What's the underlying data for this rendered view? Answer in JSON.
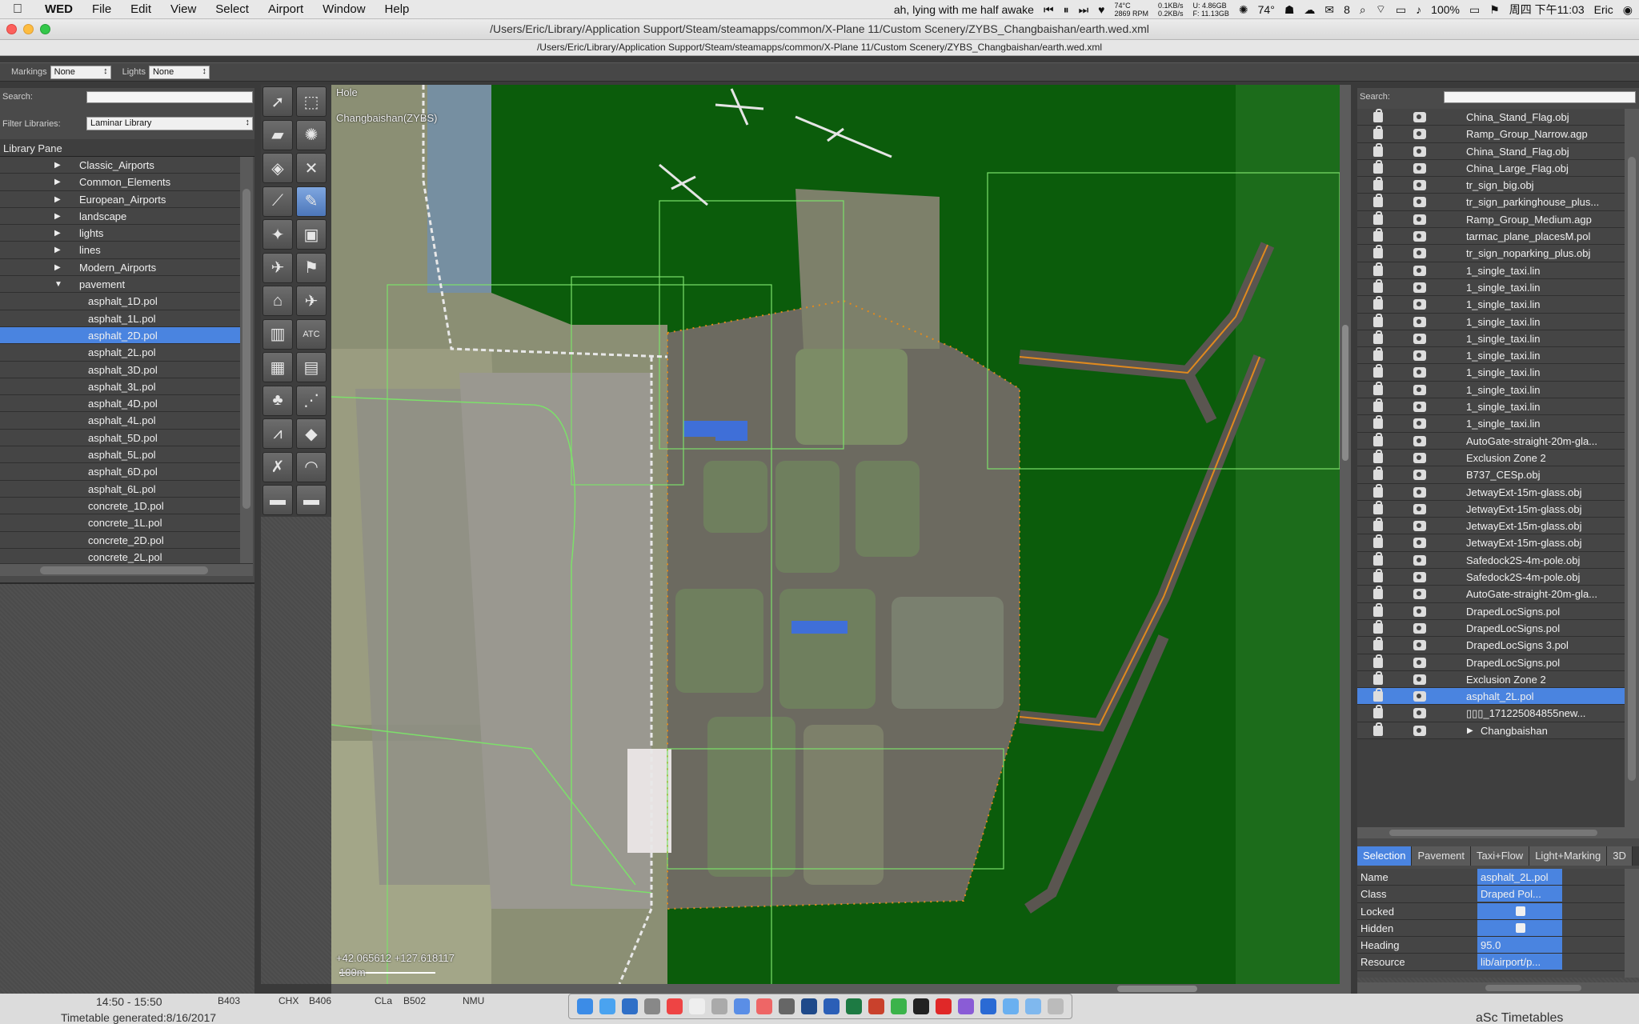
{
  "menubar": {
    "app": "WED",
    "items": [
      "File",
      "Edit",
      "View",
      "Select",
      "Airport",
      "Window",
      "Help"
    ],
    "now_playing": "ah, lying with me half awake",
    "cpu_temp": "74°C",
    "rpm": "2869 RPM",
    "net_up": "0.1KB/s",
    "net_down": "0.2KB/s",
    "mem_used": "U: 4.86GB",
    "mem_free": "F: 11.13GB",
    "weather": "74°",
    "wechat_count": "8",
    "battery": "100%",
    "clock": "周四 下午11:03",
    "user": "Eric"
  },
  "window": {
    "title": "/Users/Eric/Library/Application Support/Steam/steamapps/common/X-Plane 11/Custom Scenery/ZYBS_Changbaishan/earth.wed.xml",
    "subtitle": "/Users/Eric/Library/Application Support/Steam/steamapps/common/X-Plane 11/Custom Scenery/ZYBS_Changbaishan/earth.wed.xml"
  },
  "toolbar": {
    "markings_label": "Markings",
    "markings_value": "None",
    "lights_label": "Lights",
    "lights_value": "None"
  },
  "library": {
    "search_label": "Search:",
    "filter_label": "Filter Libraries:",
    "filter_value": "Laminar Library",
    "header": "Library Pane",
    "items": [
      {
        "label": "Classic_Airports",
        "level": 1,
        "folder": true,
        "open": false
      },
      {
        "label": "Common_Elements",
        "level": 1,
        "folder": true,
        "open": false
      },
      {
        "label": "European_Airports",
        "level": 1,
        "folder": true,
        "open": false
      },
      {
        "label": "landscape",
        "level": 1,
        "folder": true,
        "open": false
      },
      {
        "label": "lights",
        "level": 1,
        "folder": true,
        "open": false
      },
      {
        "label": "lines",
        "level": 1,
        "folder": true,
        "open": false
      },
      {
        "label": "Modern_Airports",
        "level": 1,
        "folder": true,
        "open": false
      },
      {
        "label": "pavement",
        "level": 1,
        "folder": true,
        "open": true
      },
      {
        "label": "asphalt_1D.pol",
        "level": 2
      },
      {
        "label": "asphalt_1L.pol",
        "level": 2
      },
      {
        "label": "asphalt_2D.pol",
        "level": 2,
        "selected": true
      },
      {
        "label": "asphalt_2L.pol",
        "level": 2
      },
      {
        "label": "asphalt_3D.pol",
        "level": 2
      },
      {
        "label": "asphalt_3L.pol",
        "level": 2
      },
      {
        "label": "asphalt_4D.pol",
        "level": 2
      },
      {
        "label": "asphalt_4L.pol",
        "level": 2
      },
      {
        "label": "asphalt_5D.pol",
        "level": 2
      },
      {
        "label": "asphalt_5L.pol",
        "level": 2
      },
      {
        "label": "asphalt_6D.pol",
        "level": 2
      },
      {
        "label": "asphalt_6L.pol",
        "level": 2
      },
      {
        "label": "concrete_1D.pol",
        "level": 2
      },
      {
        "label": "concrete_1L.pol",
        "level": 2
      },
      {
        "label": "concrete_2D.pol",
        "level": 2
      },
      {
        "label": "concrete_2L.pol",
        "level": 2
      }
    ]
  },
  "tools": [
    {
      "icon": "arrow-select-icon",
      "glyph": "➚"
    },
    {
      "icon": "marquee-icon",
      "glyph": "⬚"
    },
    {
      "icon": "runway-icon",
      "glyph": "▰"
    },
    {
      "icon": "helipad-icon",
      "glyph": "✺"
    },
    {
      "icon": "taxiway-icon",
      "glyph": "◈"
    },
    {
      "icon": "boundary-icon",
      "glyph": "✕"
    },
    {
      "icon": "line-icon",
      "glyph": "⟋"
    },
    {
      "icon": "bezier-icon",
      "glyph": "✎",
      "active": true
    },
    {
      "icon": "light-icon",
      "glyph": "✦"
    },
    {
      "icon": "sign-icon",
      "glyph": "▣"
    },
    {
      "icon": "ramp-start-icon",
      "glyph": "✈"
    },
    {
      "icon": "windsock-icon",
      "glyph": "⚑"
    },
    {
      "icon": "tower-icon",
      "glyph": "⌂"
    },
    {
      "icon": "truck-icon",
      "glyph": "✈"
    },
    {
      "icon": "fence-icon",
      "glyph": "▥"
    },
    {
      "icon": "atc-icon",
      "glyph": "ATC"
    },
    {
      "icon": "facade-icon",
      "glyph": "▦"
    },
    {
      "icon": "forest-icon",
      "glyph": "▤"
    },
    {
      "icon": "tree-icon",
      "glyph": "♣"
    },
    {
      "icon": "string-icon",
      "glyph": "⋰"
    },
    {
      "icon": "polyline-icon",
      "glyph": "⩘"
    },
    {
      "icon": "polygon-icon",
      "glyph": "◆"
    },
    {
      "icon": "exclusion-icon",
      "glyph": "✗"
    },
    {
      "icon": "route-icon",
      "glyph": "◠"
    },
    {
      "icon": "vehicle-icon",
      "glyph": "▬"
    },
    {
      "icon": "autogen-icon",
      "glyph": "▬"
    }
  ],
  "map": {
    "tool_name": "Hole",
    "airport_label": "Changbaishan(ZYBS)",
    "coordinates": "+42.065612  +127.618117",
    "scale_label": "100m",
    "colors": {
      "ground": "#0b5c0b",
      "pavement": "#5a5550",
      "edge": "#e08a1e",
      "selection": "#7ce06a"
    }
  },
  "hierarchy": {
    "search_label": "Search:",
    "items": [
      {
        "label": "China_Stand_Flag.obj"
      },
      {
        "label": "Ramp_Group_Narrow.agp"
      },
      {
        "label": "China_Stand_Flag.obj"
      },
      {
        "label": "China_Large_Flag.obj"
      },
      {
        "label": "tr_sign_big.obj"
      },
      {
        "label": "tr_sign_parkinghouse_plus..."
      },
      {
        "label": "Ramp_Group_Medium.agp"
      },
      {
        "label": "tarmac_plane_placesM.pol"
      },
      {
        "label": "tr_sign_noparking_plus.obj"
      },
      {
        "label": "1_single_taxi.lin"
      },
      {
        "label": "1_single_taxi.lin"
      },
      {
        "label": "1_single_taxi.lin"
      },
      {
        "label": "1_single_taxi.lin"
      },
      {
        "label": "1_single_taxi.lin"
      },
      {
        "label": "1_single_taxi.lin"
      },
      {
        "label": "1_single_taxi.lin"
      },
      {
        "label": "1_single_taxi.lin"
      },
      {
        "label": "1_single_taxi.lin"
      },
      {
        "label": "1_single_taxi.lin"
      },
      {
        "label": "AutoGate-straight-20m-gla..."
      },
      {
        "label": "Exclusion Zone 2"
      },
      {
        "label": "B737_CESp.obj"
      },
      {
        "label": "JetwayExt-15m-glass.obj"
      },
      {
        "label": "JetwayExt-15m-glass.obj"
      },
      {
        "label": "JetwayExt-15m-glass.obj"
      },
      {
        "label": "JetwayExt-15m-glass.obj"
      },
      {
        "label": "Safedock2S-4m-pole.obj"
      },
      {
        "label": "Safedock2S-4m-pole.obj"
      },
      {
        "label": "AutoGate-straight-20m-gla..."
      },
      {
        "label": "DrapedLocSigns.pol"
      },
      {
        "label": "DrapedLocSigns.pol"
      },
      {
        "label": "DrapedLocSigns 3.pol"
      },
      {
        "label": "DrapedLocSigns.pol"
      },
      {
        "label": "Exclusion Zone 2"
      },
      {
        "label": "asphalt_2L.pol",
        "selected": true
      },
      {
        "label": "▯▯▯_171225084855new..."
      },
      {
        "label": "Changbaishan",
        "folder": true
      }
    ]
  },
  "property_tabs": [
    {
      "label": "Selection",
      "active": true
    },
    {
      "label": "Pavement"
    },
    {
      "label": "Taxi+Flow"
    },
    {
      "label": "Light+Marking"
    },
    {
      "label": "3D"
    }
  ],
  "properties": [
    {
      "key": "Name",
      "value": "asphalt_2L.pol"
    },
    {
      "key": "Class",
      "value": "Draped Pol..."
    },
    {
      "key": "Locked",
      "value": "",
      "checkbox": true
    },
    {
      "key": "Hidden",
      "value": "",
      "checkbox": true
    },
    {
      "key": "Heading",
      "value": "95.0"
    },
    {
      "key": "Resource",
      "value": "lib/airport/p..."
    }
  ],
  "desktop": {
    "time_range": "14:50 - 15:50",
    "codes": [
      "B403",
      "CHX",
      "B406",
      "CLa",
      "B502",
      "NMU"
    ],
    "generated": "Timetable generated:8/16/2017",
    "right_text": "aSc Timetables"
  }
}
